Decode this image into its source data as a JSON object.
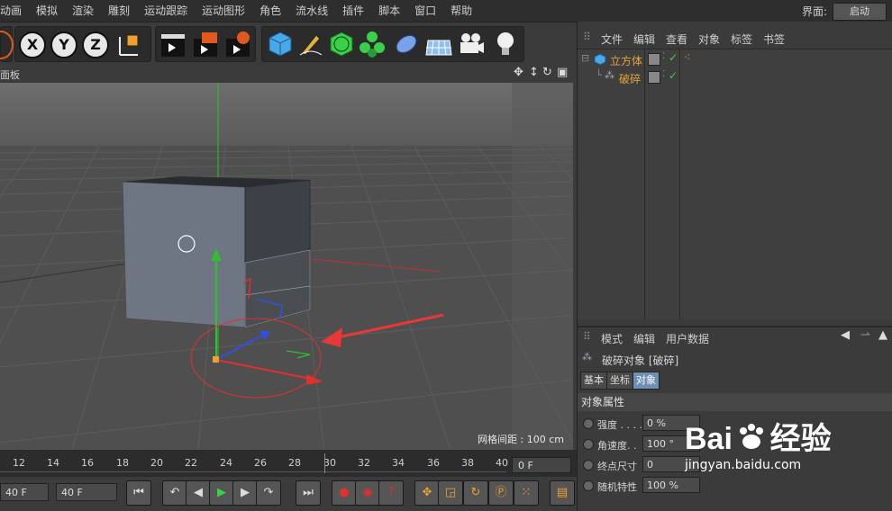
{
  "menubar": {
    "items": [
      "动画",
      "模拟",
      "渲染",
      "雕刻",
      "运动跟踪",
      "运动图形",
      "角色",
      "流水线",
      "插件",
      "脚本",
      "窗口",
      "帮助"
    ],
    "layout_label": "界面:",
    "layout_value": "启动"
  },
  "viewport": {
    "panel_label": "面板",
    "grid_distance": "网格间距 : 100 cm"
  },
  "timeline": {
    "ticks": [
      "12",
      "14",
      "16",
      "18",
      "20",
      "22",
      "24",
      "26",
      "28",
      "30",
      "32",
      "34",
      "36",
      "38",
      "40"
    ],
    "current_frame": "0 F"
  },
  "transport": {
    "start_field": "40 F",
    "end_field": "40 F"
  },
  "object_manager": {
    "menu": [
      "文件",
      "编辑",
      "查看",
      "对象",
      "标签",
      "书签"
    ],
    "objects": [
      {
        "name": "立方体",
        "color": "#e8a33c"
      },
      {
        "name": "破碎",
        "color": "#e8a33c"
      }
    ]
  },
  "attributes": {
    "menu": [
      "模式",
      "编辑",
      "用户数据"
    ],
    "title": "破碎对象 [破碎]",
    "tabs": [
      "基本",
      "坐标",
      "对象"
    ],
    "active_tab": "对象",
    "section": "对象属性",
    "properties": [
      {
        "label": "强度 . . . .",
        "value": "0 %"
      },
      {
        "label": "角速度. .",
        "value": "100 °"
      },
      {
        "label": "终点尺寸",
        "value": "0"
      },
      {
        "label": "随机特性",
        "value": "100 %"
      }
    ]
  },
  "watermark": {
    "brand": "Bai",
    "brand2": "经验",
    "url": "jingyan.baidu.com"
  },
  "colors": {
    "accent_active_tab": "#6f8fb3",
    "object_name": "#e8a33c",
    "axis_x": "#e03030",
    "axis_y": "#2ec02e",
    "axis_z": "#3050e0"
  }
}
